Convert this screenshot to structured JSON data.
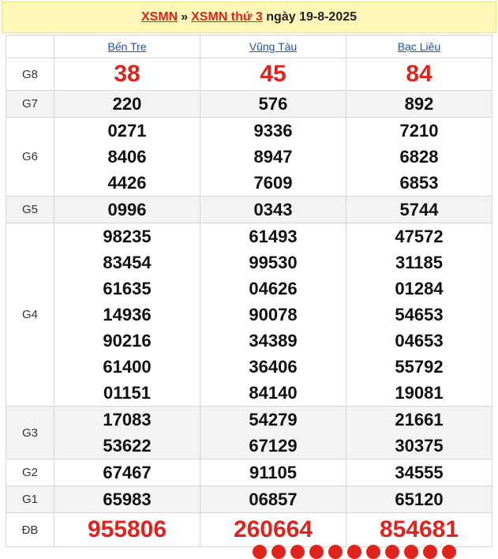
{
  "header": {
    "link1": "XSMN",
    "separator": "»",
    "link2": "XSMN thứ 3",
    "date_text": "ngày 19-8-2025"
  },
  "provinces": [
    "Bến Tre",
    "Vũng Tàu",
    "Bạc Liêu"
  ],
  "prizes": [
    {
      "label": "G8",
      "style": "big",
      "values": [
        [
          "38"
        ],
        [
          "45"
        ],
        [
          "84"
        ]
      ]
    },
    {
      "label": "G7",
      "style": "num",
      "values": [
        [
          "220"
        ],
        [
          "576"
        ],
        [
          "892"
        ]
      ]
    },
    {
      "label": "G6",
      "style": "num",
      "values": [
        [
          "0271",
          "8406",
          "4426"
        ],
        [
          "9336",
          "8947",
          "7609"
        ],
        [
          "7210",
          "6828",
          "6853"
        ]
      ]
    },
    {
      "label": "G5",
      "style": "num",
      "values": [
        [
          "0996"
        ],
        [
          "0343"
        ],
        [
          "5744"
        ]
      ]
    },
    {
      "label": "G4",
      "style": "num",
      "values": [
        [
          "98235",
          "83454",
          "61635",
          "14936",
          "90216",
          "61400",
          "01151"
        ],
        [
          "61493",
          "99530",
          "04626",
          "90078",
          "34389",
          "36406",
          "84140"
        ],
        [
          "47572",
          "31185",
          "01284",
          "54653",
          "04653",
          "55792",
          "19081"
        ]
      ]
    },
    {
      "label": "G3",
      "style": "num",
      "values": [
        [
          "17083",
          "53622"
        ],
        [
          "54279",
          "67129"
        ],
        [
          "21661",
          "30375"
        ]
      ]
    },
    {
      "label": "G2",
      "style": "num",
      "values": [
        [
          "67467"
        ],
        [
          "91105"
        ],
        [
          "34555"
        ]
      ]
    },
    {
      "label": "G1",
      "style": "num",
      "values": [
        [
          "65983"
        ],
        [
          "06857"
        ],
        [
          "65120"
        ]
      ]
    },
    {
      "label": "ĐB",
      "style": "bigdb",
      "values": [
        [
          "955806"
        ],
        [
          "260664"
        ],
        [
          "854681"
        ]
      ]
    }
  ],
  "colors": {
    "accent": "#e0231c",
    "header_bg": "#fff7b8",
    "link": "#1a4fb5"
  }
}
